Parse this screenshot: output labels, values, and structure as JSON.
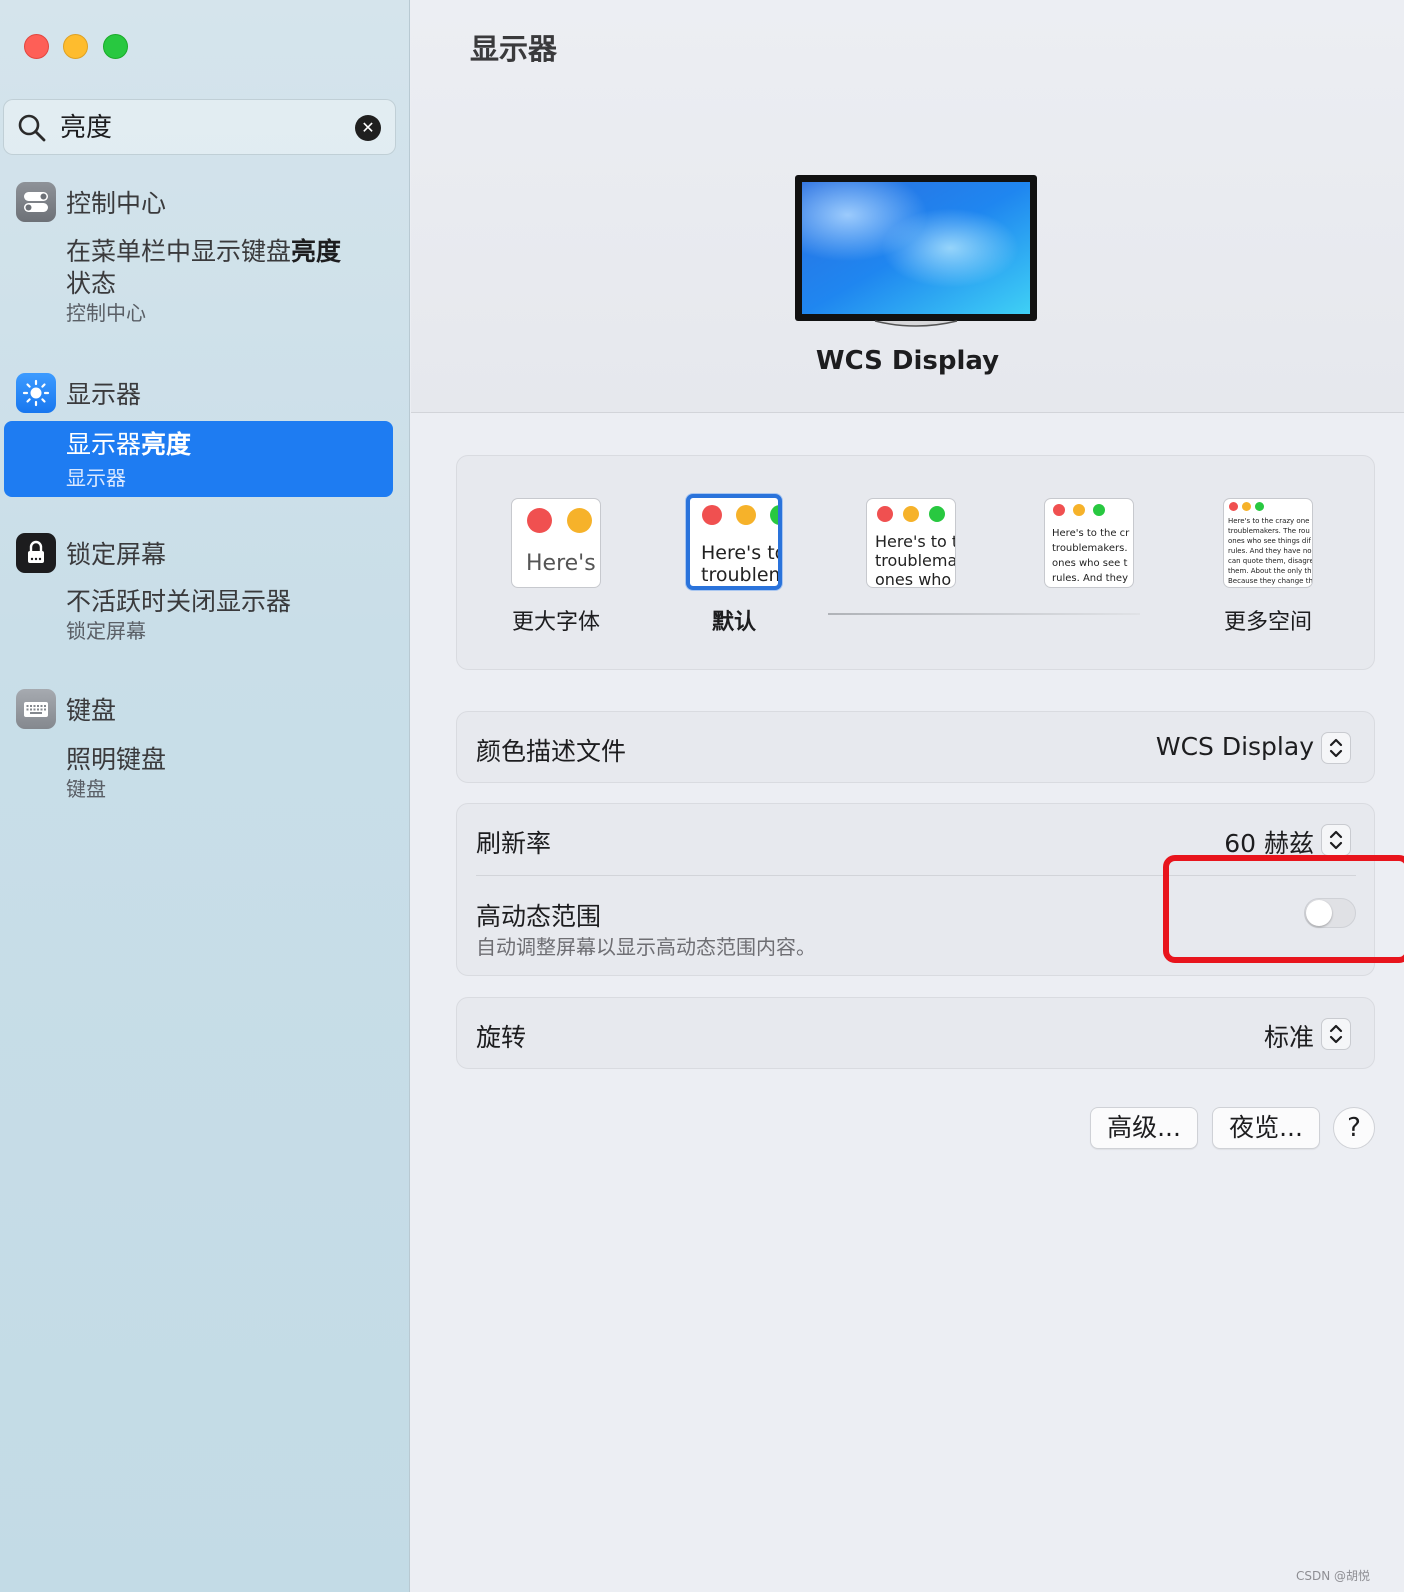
{
  "window": {
    "traffic_lights": [
      "close",
      "minimize",
      "zoom"
    ]
  },
  "search": {
    "query": "亮度",
    "icon": "search-icon",
    "clear_icon": "clear-icon"
  },
  "sidebar": {
    "groups": [
      {
        "title": "控制中心",
        "icon": "control-center-icon",
        "results": [
          {
            "title_prefix": "在菜单栏中显示键盘",
            "title_highlight": "亮度",
            "title_line2": "状态",
            "subtitle": "控制中心"
          }
        ]
      },
      {
        "title": "显示器",
        "icon": "display-brightness-icon",
        "results": [
          {
            "title_prefix": "显示器",
            "title_highlight": "亮度",
            "subtitle": "显示器",
            "selected": true
          }
        ]
      },
      {
        "title": "锁定屏幕",
        "icon": "lock-icon",
        "results": [
          {
            "title": "不活跃时关闭显示器",
            "subtitle": "锁定屏幕"
          }
        ]
      },
      {
        "title": "键盘",
        "icon": "keyboard-icon",
        "results": [
          {
            "title": "照明键盘",
            "subtitle": "键盘"
          }
        ]
      }
    ]
  },
  "main": {
    "title": "显示器",
    "display_name": "WCS Display",
    "resolution": {
      "options": [
        {
          "label": "更大字体",
          "sample": "Here's"
        },
        {
          "label": "默认",
          "sample": "Here's to\ntroublem",
          "selected": true
        },
        {
          "label": "",
          "sample": "Here's to t\ntroublema\nones who"
        },
        {
          "label": "",
          "sample": "Here's to the cr\ntroublemakers.\nones who see t\nrules. And they"
        },
        {
          "label": "更多空间",
          "sample": "Here's to the crazy one\ntroublemakers. The rou\nones who see things dif\nrules. And they have no\ncan quote them, disagre\nthem. About the only th\nBecause they change th"
        }
      ]
    },
    "color_profile": {
      "label": "颜色描述文件",
      "value": "WCS Display"
    },
    "refresh_rate": {
      "label": "刷新率",
      "value": "60 赫兹"
    },
    "hdr": {
      "label": "高动态范围",
      "description": "自动调整屏幕以显示高动态范围内容。",
      "enabled": false
    },
    "rotation": {
      "label": "旋转",
      "value": "标准"
    },
    "buttons": {
      "advanced": "高级...",
      "night_shift": "夜览...",
      "help": "?"
    }
  },
  "watermark": "CSDN @胡悦",
  "colors": {
    "accent": "#1e7cf2",
    "highlight_box": "#e8141c",
    "traffic_close": "#fe5f57",
    "traffic_min": "#febc2e",
    "traffic_max": "#28c840"
  }
}
